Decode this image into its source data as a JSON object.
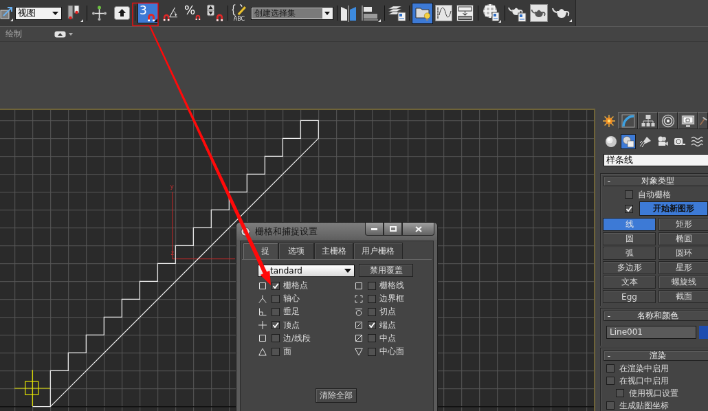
{
  "toolbar": {
    "view_dropdown": {
      "value": "视图"
    },
    "snap_toggles": [
      {
        "kind": "dimension",
        "label": "3",
        "selected": true
      },
      {
        "kind": "angle",
        "selected": false
      },
      {
        "kind": "percent",
        "label": "%",
        "selected": false
      },
      {
        "kind": "spinner",
        "selected": false
      }
    ],
    "named_sets_caption": "ABC",
    "selection_set_dropdown": {
      "placeholder": "创建选择集"
    },
    "scene_explorer_toggle": {
      "selected": true
    }
  },
  "ribbon": {
    "label": "绘制"
  },
  "viewport": {
    "axis_labels": [
      "y",
      "z"
    ]
  },
  "dialog": {
    "title": "栅格和捕捉设置",
    "tabs": [
      {
        "label": "捉",
        "selected": true
      },
      {
        "label": "选项",
        "selected": false
      },
      {
        "label": "主栅格",
        "selected": false
      },
      {
        "label": "用户栅格",
        "selected": false
      }
    ],
    "preset_dropdown": {
      "value": "tandard"
    },
    "override_button": "禁用覆盖",
    "snaps": [
      {
        "kind": "grid-point",
        "label": "栅格点",
        "checked": true
      },
      {
        "kind": "pivot",
        "label": "轴心",
        "checked": false
      },
      {
        "kind": "perpendicular",
        "label": "垂足",
        "checked": false
      },
      {
        "kind": "vertex",
        "label": "顶点",
        "checked": true
      },
      {
        "kind": "edge",
        "label": "边/线段",
        "checked": false
      },
      {
        "kind": "face",
        "label": "面",
        "checked": false
      },
      {
        "kind": "grid-line",
        "label": "栅格线",
        "checked": false
      },
      {
        "kind": "bounding-box",
        "label": "边界框",
        "checked": false
      },
      {
        "kind": "tangent",
        "label": "切点",
        "checked": false
      },
      {
        "kind": "endpoint",
        "label": "端点",
        "checked": true
      },
      {
        "kind": "midpoint",
        "label": "中点",
        "checked": false
      },
      {
        "kind": "center-face",
        "label": "中心面",
        "checked": false
      }
    ],
    "clear_button": "清除全部"
  },
  "command_panel": {
    "tabs": [
      {
        "kind": "create",
        "selected": true
      },
      {
        "kind": "modify",
        "selected": false
      },
      {
        "kind": "hierarchy",
        "selected": false
      },
      {
        "kind": "motion",
        "selected": false
      },
      {
        "kind": "display",
        "selected": false
      },
      {
        "kind": "utilities",
        "selected": false
      }
    ],
    "categories": [
      {
        "kind": "geometry",
        "selected": false
      },
      {
        "kind": "shapes",
        "selected": true
      },
      {
        "kind": "lights",
        "selected": false
      },
      {
        "kind": "cameras",
        "selected": false
      },
      {
        "kind": "helpers",
        "selected": false
      },
      {
        "kind": "space-warps",
        "selected": false
      }
    ],
    "type_dropdown": {
      "value": "样条线"
    },
    "object_type": {
      "toggle": "-",
      "title": "对象类型",
      "auto_grid": {
        "label": "自动栅格",
        "checked": false
      },
      "start_new_shape": {
        "label": "开始新图形",
        "checked": true,
        "on": true
      },
      "buttons": [
        {
          "label": "线",
          "selected": true
        },
        {
          "label": "矩形",
          "selected": false
        },
        {
          "label": "圆",
          "selected": false
        },
        {
          "label": "椭圆",
          "selected": false
        },
        {
          "label": "弧",
          "selected": false
        },
        {
          "label": "圆环",
          "selected": false
        },
        {
          "label": "多边形",
          "selected": false
        },
        {
          "label": "星形",
          "selected": false
        },
        {
          "label": "文本",
          "selected": false
        },
        {
          "label": "螺旋线",
          "selected": false
        },
        {
          "label": "Egg",
          "selected": false
        },
        {
          "label": "截面",
          "selected": false
        }
      ]
    },
    "name_and_color": {
      "toggle": "-",
      "title": "名称和颜色",
      "name": "Line001",
      "color": "#1f4db0"
    },
    "rendering": {
      "toggle": "-",
      "title": "渲染",
      "options": [
        {
          "label": "在渲染中启用",
          "checked": false
        },
        {
          "label": "在视口中启用",
          "checked": false,
          "children": [
            {
              "label": "使用视口设置",
              "checked": false
            }
          ]
        },
        {
          "label": "生成贴图坐标",
          "checked": false
        }
      ]
    }
  }
}
